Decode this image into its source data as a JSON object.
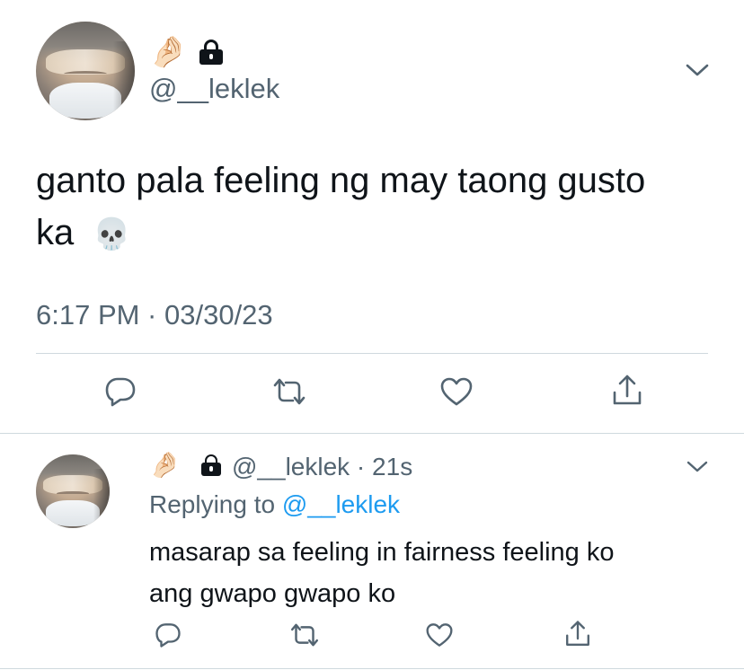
{
  "main_tweet": {
    "handle": "@__leklek",
    "emoji_badge": "🤌🏻",
    "text_line1": "ganto pala feeling ng may taong gusto",
    "text_line2": "ka",
    "text_emoji": "💀",
    "timestamp": "6:17 PM · 03/30/23",
    "icons": [
      "chevron-down-icon",
      "lock-icon",
      "reply-icon",
      "retweet-icon",
      "like-icon",
      "share-icon"
    ]
  },
  "reply_tweet": {
    "emoji_badge": "🤌🏻",
    "handle": "@__leklek",
    "separator": " · ",
    "time_ago": "21s",
    "replying_to_label": "Replying to",
    "replying_to_handle": "@__leklek",
    "text_line1": "masarap sa feeling in fairness feeling ko",
    "text_line2": "ang gwapo gwapo ko",
    "icons": [
      "chevron-down-icon",
      "lock-icon",
      "reply-icon",
      "retweet-icon",
      "like-icon",
      "share-icon"
    ]
  },
  "colors": {
    "text": "#0f1419",
    "secondary": "#536471",
    "link": "#1d9bf0",
    "divider": "#cfd9de"
  }
}
